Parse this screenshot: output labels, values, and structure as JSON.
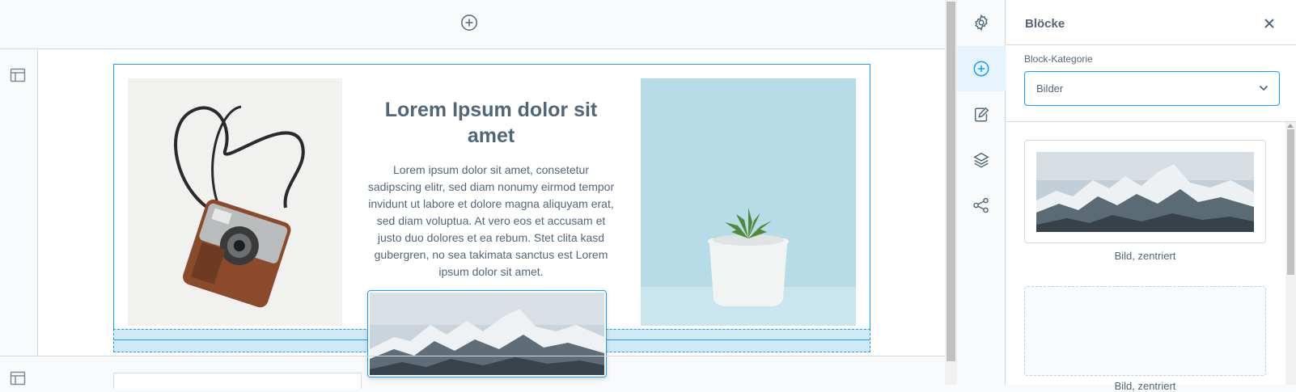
{
  "canvas": {
    "content_block": {
      "title": "Lorem Ipsum dolor sit amet",
      "body": "Lorem ipsum dolor sit amet, consetetur sadipscing elitr, sed diam nonumy eirmod tempor invidunt ut labore et dolore magna aliquyam erat, sed diam voluptua. At vero eos et accusam et justo duo dolores et ea rebum. Stet clita kasd gubergren, no sea takimata sanctus est Lorem ipsum dolor sit amet."
    },
    "icons": {
      "add_block": "plus-circle-icon",
      "section_layout": "layout-icon"
    }
  },
  "tools": [
    {
      "name": "settings",
      "icon": "gear-icon",
      "active": false
    },
    {
      "name": "add-blocks",
      "icon": "plus-circle-icon",
      "active": true
    },
    {
      "name": "edit",
      "icon": "edit-icon",
      "active": false
    },
    {
      "name": "layers",
      "icon": "layers-icon",
      "active": false
    },
    {
      "name": "share",
      "icon": "share-icon",
      "active": false
    }
  ],
  "panel": {
    "title": "Blöcke",
    "close_icon": "close-icon",
    "category_label": "Block-Kategorie",
    "category_value": "Bilder",
    "blocks": [
      {
        "label": "Bild, zentriert"
      },
      {
        "label": "Bild, zentriert"
      }
    ]
  },
  "colors": {
    "accent": "#189eff",
    "text": "#52667a",
    "border": "#d1d9e0",
    "drop_zone": "#cfe9f7"
  }
}
